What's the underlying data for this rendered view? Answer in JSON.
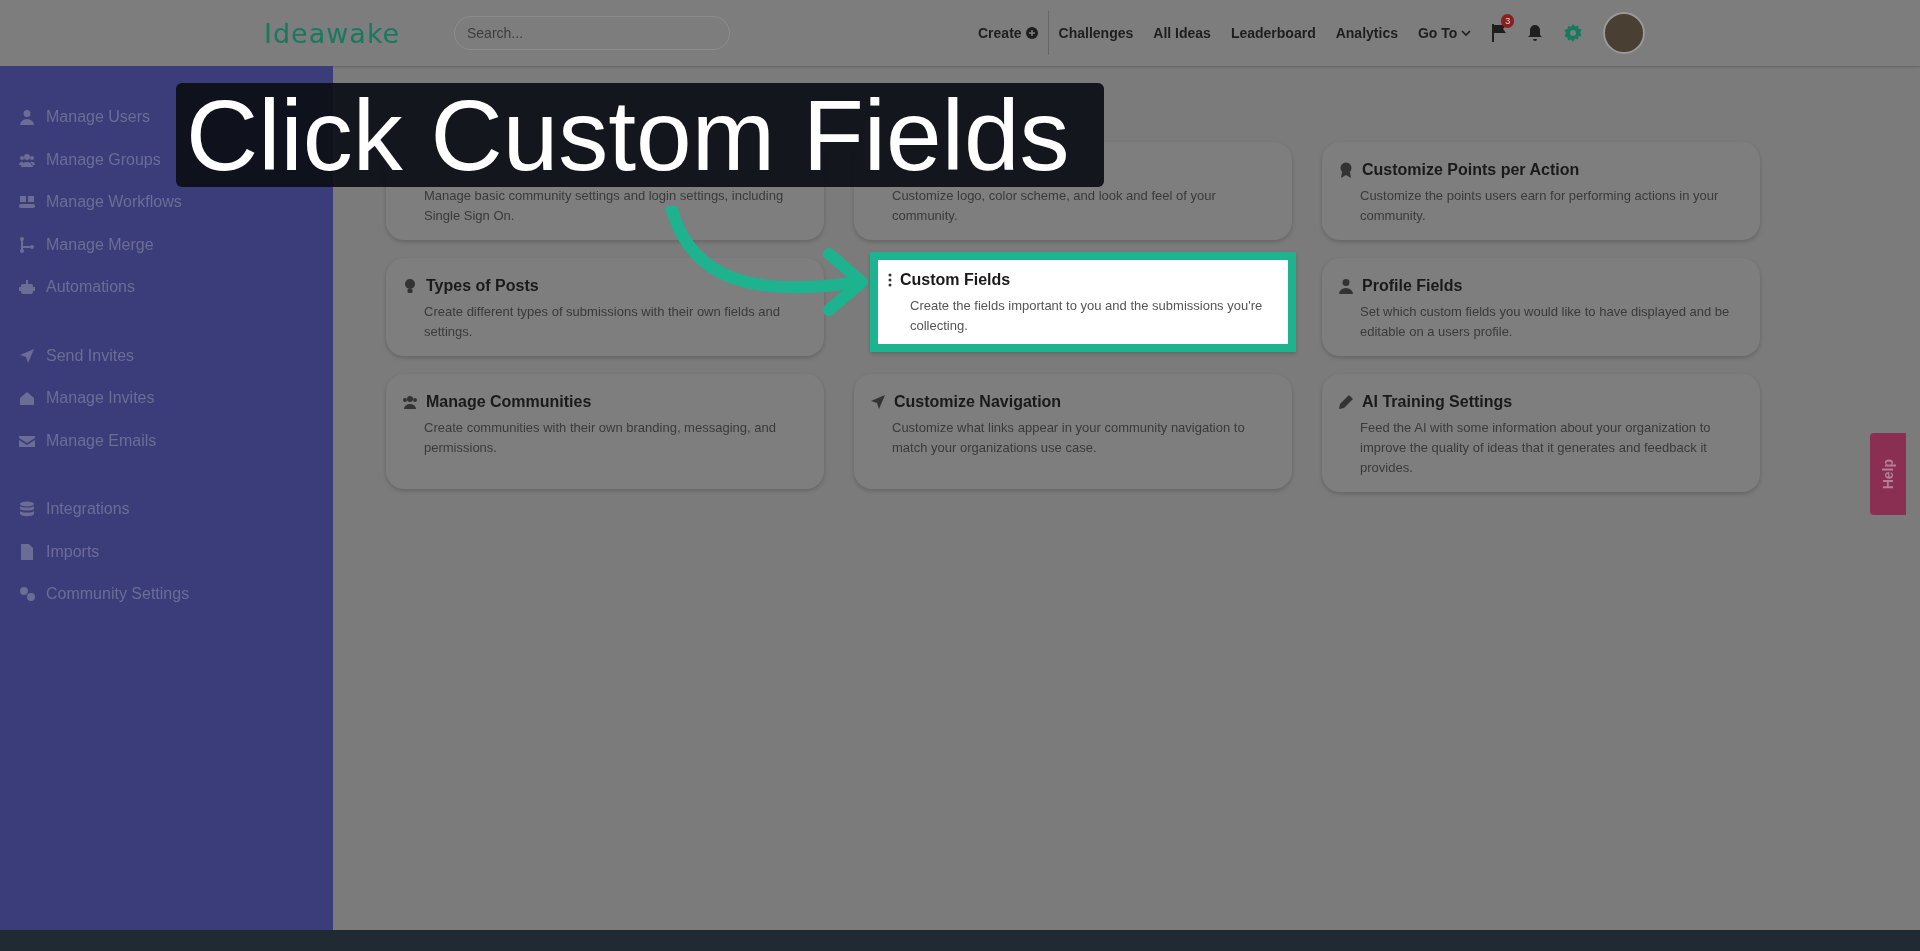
{
  "header": {
    "logo": "Ideawake",
    "search": {
      "placeholder": "Search..."
    },
    "nav": [
      {
        "label": "Create",
        "kind": "create"
      },
      {
        "label": "Challenges",
        "kind": "link"
      },
      {
        "label": "All Ideas",
        "kind": "link"
      },
      {
        "label": "Leaderboard",
        "kind": "link"
      },
      {
        "label": "Analytics",
        "kind": "link"
      },
      {
        "label": "Go To",
        "kind": "dropdown"
      }
    ],
    "flag_badge": "3"
  },
  "sidebar": {
    "sections": [
      [
        {
          "label": "Manage Users"
        },
        {
          "label": "Manage Groups"
        },
        {
          "label": "Manage Workflows"
        },
        {
          "label": "Manage Merge"
        },
        {
          "label": "Automations"
        }
      ],
      [
        {
          "label": "Send Invites"
        },
        {
          "label": "Manage Invites"
        },
        {
          "label": "Manage Emails"
        }
      ],
      [
        {
          "label": "Integrations"
        },
        {
          "label": "Imports"
        },
        {
          "label": "Community Settings"
        }
      ]
    ]
  },
  "cards": [
    {
      "description": "Manage basic community settings and login settings, including Single Sign On.",
      "highlighted": false
    },
    {
      "description": "Customize logo, color scheme, and look and feel of your community.",
      "highlighted": false
    },
    {
      "title": "Customize Points per Action",
      "description": "Customize the points users earn for performing actions in your community.",
      "highlighted": false
    },
    {
      "title": "Types of Posts",
      "description": "Create different types of submissions with their own fields and settings.",
      "highlighted": false
    },
    {
      "title": "Custom Fields",
      "description": "Create the fields important to you and the submissions you're collecting.",
      "highlighted": true
    },
    {
      "title": "Profile Fields",
      "description": "Set which custom fields you would like to have displayed and be editable on a users profile.",
      "highlighted": false
    },
    {
      "title": "Manage Communities",
      "description": "Create communities with their own branding, messaging, and permissions.",
      "highlighted": false
    },
    {
      "title": "Customize Navigation",
      "description": "Customize what links appear in your community navigation to match your organizations use case.",
      "highlighted": false
    },
    {
      "title": "AI Training Settings",
      "description": "Feed the AI with some information about your organization to improve the quality of ideas that it generates and feedback it provides.",
      "highlighted": false
    }
  ],
  "help_tab": "Help",
  "caption": "Click Custom Fields"
}
